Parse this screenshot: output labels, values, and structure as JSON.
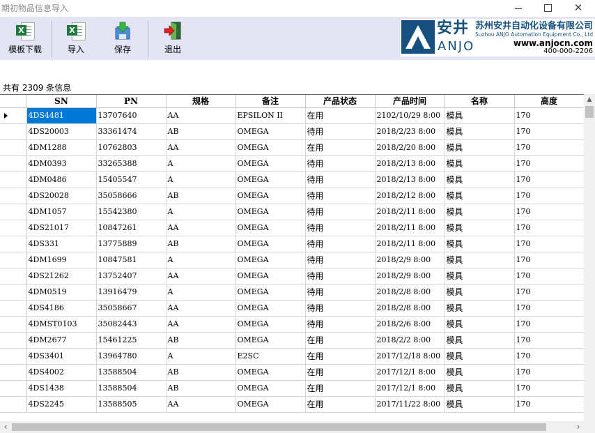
{
  "window": {
    "title": "期初物品信息导入",
    "minimize_icon": "minimize-icon",
    "maximize_icon": "maximize-icon",
    "close_icon": "close-icon"
  },
  "toolbar": {
    "buttons": [
      {
        "label": "模板下载",
        "icon": "excel-icon"
      },
      {
        "label": "导入",
        "icon": "excel-icon"
      },
      {
        "label": "保存",
        "icon": "save-icon"
      },
      {
        "label": "退出",
        "icon": "exit-icon"
      }
    ]
  },
  "logo": {
    "brand_cn": "安井",
    "brand_en": "ANJO",
    "company_cn": "苏州安井自动化设备有限公司",
    "company_en": "Suzhou ANJO Automation Equipment Co., Ltd",
    "website": "www.anjocn.com",
    "phone": "400-000-2206",
    "colors": {
      "brand": "#15507f"
    }
  },
  "count_text": "共有 2309 条信息",
  "grid": {
    "columns": [
      "SN",
      "PN",
      "规格",
      "备注",
      "产品状态",
      "产品时间",
      "名称",
      "高度"
    ],
    "rows": [
      [
        "4DS4481",
        "13707640",
        "AA",
        "EPSILON II",
        "在用",
        "2102/10/29 8:00",
        "模具",
        "170"
      ],
      [
        "4DS20003",
        "33361474",
        "AB",
        "OMEGA",
        "待用",
        "2018/2/23 8:00",
        "模具",
        "170"
      ],
      [
        "4DM1288",
        "10762803",
        "AA",
        "OMEGA",
        "在用",
        "2018/2/20 8:00",
        "模具",
        "170"
      ],
      [
        "4DM0393",
        "33265388",
        "A",
        "OMEGA",
        "待用",
        "2018/2/13 8:00",
        "模具",
        "170"
      ],
      [
        "4DM0486",
        "15405547",
        "A",
        "OMEGA",
        "待用",
        "2018/2/13 8:00",
        "模具",
        "170"
      ],
      [
        "4DS20028",
        "35058666",
        "AB",
        "OMEGA",
        "待用",
        "2018/2/12 8:00",
        "模具",
        "170"
      ],
      [
        "4DM1057",
        "15542380",
        "A",
        "OMEGA",
        "待用",
        "2018/2/11 8:00",
        "模具",
        "170"
      ],
      [
        "4DS21017",
        "10847261",
        "AA",
        "OMEGA",
        "待用",
        "2018/2/11 8:00",
        "模具",
        "170"
      ],
      [
        "4DS331",
        "13775889",
        "AB",
        "OMEGA",
        "待用",
        "2018/2/11 8:00",
        "模具",
        "170"
      ],
      [
        "4DM1699",
        "10847581",
        "A",
        "OMEGA",
        "待用",
        "2018/2/9 8:00",
        "模具",
        "170"
      ],
      [
        "4DS21262",
        "13752407",
        "AA",
        "OMEGA",
        "待用",
        "2018/2/9 8:00",
        "模具",
        "170"
      ],
      [
        "4DM0519",
        "13916479",
        "A",
        "OMEGA",
        "待用",
        "2018/2/8 8:00",
        "模具",
        "170"
      ],
      [
        "4DS4186",
        "35058667",
        "AA",
        "OMEGA",
        "待用",
        "2018/2/8 8:00",
        "模具",
        "170"
      ],
      [
        "4DMST0103",
        "35082443",
        "AA",
        "OMEGA",
        "待用",
        "2018/2/6 8:00",
        "模具",
        "170"
      ],
      [
        "4DM2677",
        "15461225",
        "AB",
        "OMEGA",
        "在用",
        "2018/2/2 8:00",
        "模具",
        "170"
      ],
      [
        "4DS3401",
        "13964780",
        "A",
        "E2SC",
        "在用",
        "2017/12/18 8:00",
        "模具",
        "170"
      ],
      [
        "4DS4002",
        "13588504",
        "AB",
        "OMEGA",
        "在用",
        "2017/12/1 8:00",
        "模具",
        "170"
      ],
      [
        "4DS1438",
        "13588504",
        "AB",
        "OMEGA",
        "在用",
        "2017/12/1 8:00",
        "模具",
        "170"
      ],
      [
        "4DS2245",
        "13588505",
        "AA",
        "OMEGA",
        "在用",
        "2017/11/22 8:00",
        "模具",
        "170"
      ]
    ]
  }
}
